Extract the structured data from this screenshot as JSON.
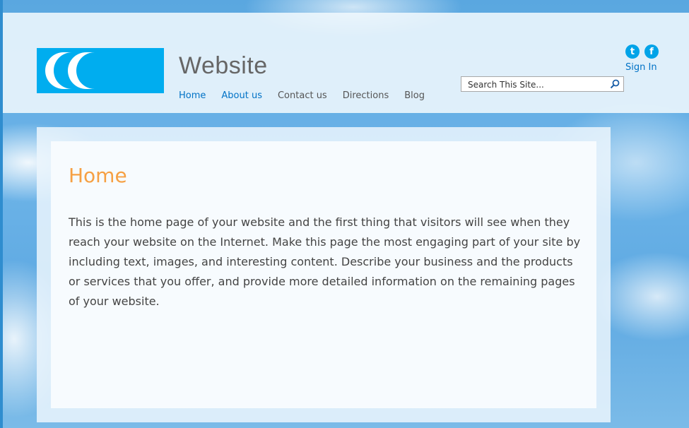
{
  "site": {
    "title": "Website"
  },
  "nav": {
    "items": [
      {
        "label": "Home"
      },
      {
        "label": "About us"
      },
      {
        "label": "Contact us"
      },
      {
        "label": "Directions"
      },
      {
        "label": "Blog"
      }
    ],
    "active_index": 0
  },
  "social": {
    "twitter_glyph": "t",
    "facebook_glyph": "f",
    "signin_label": "Sign In"
  },
  "search": {
    "placeholder": "Search This Site..."
  },
  "main": {
    "heading": "Home",
    "body": "This is the home page of your website and the first thing that visitors will see when they reach your website on the Internet. Make this page the most engaging part of your site by including text, images, and interesting content. Describe your business and the products or services that you offer, and provide more detailed information on the remaining pages of your website."
  },
  "colors": {
    "accent": "#00adef",
    "link": "#0072c6",
    "heading": "#f6a043"
  },
  "icons": [
    "logo-mark",
    "twitter-icon",
    "facebook-icon",
    "search-icon"
  ]
}
